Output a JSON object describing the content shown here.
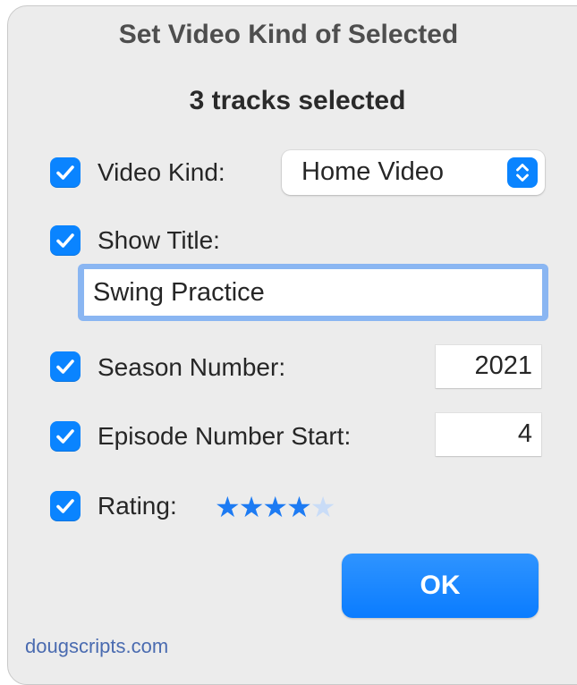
{
  "dialog": {
    "title": "Set Video Kind of Selected",
    "subtitle": "3 tracks selected"
  },
  "video_kind": {
    "label": "Video Kind:",
    "checked": true,
    "value": "Home Video"
  },
  "show_title": {
    "label": "Show Title:",
    "checked": true,
    "value": "Swing Practice"
  },
  "season_number": {
    "label": "Season Number:",
    "checked": true,
    "value": "2021"
  },
  "episode_number_start": {
    "label": "Episode Number Start:",
    "checked": true,
    "value": "4"
  },
  "rating": {
    "label": "Rating:",
    "checked": true,
    "value": 4,
    "max": 5
  },
  "ok_button": {
    "label": "OK"
  },
  "footer": {
    "credit": "dougscripts.com"
  },
  "colors": {
    "accent": "#0a84ff",
    "background": "#ececec"
  },
  "icons": {
    "checkbox": "checkmark-icon",
    "popup": "up-down-chevron-icon",
    "star": "star-icon"
  }
}
